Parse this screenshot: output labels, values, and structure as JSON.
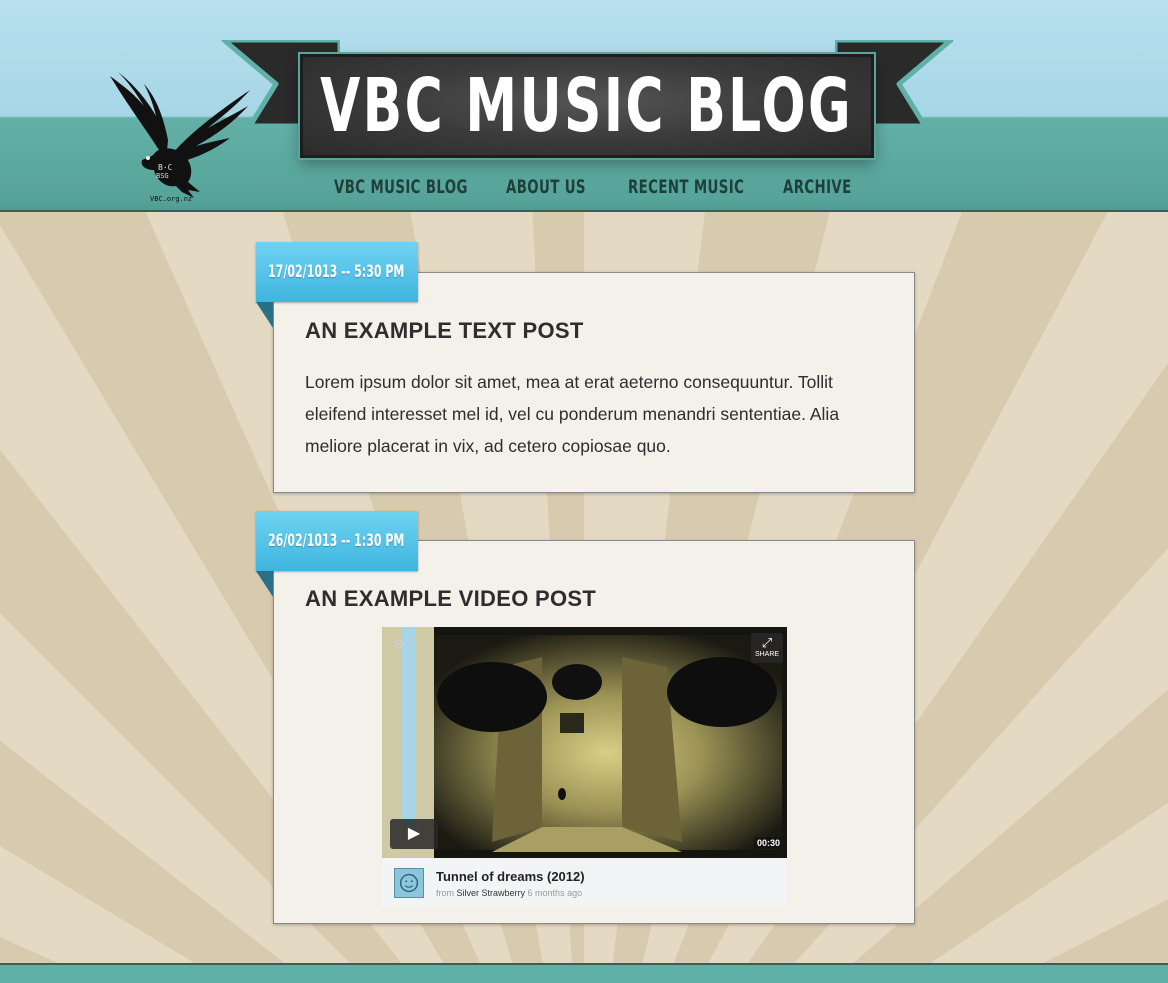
{
  "site": {
    "title": "VBC MUSIC BLOG",
    "logo_caption": "VBC.org.nz",
    "logo_icon": "eagle-icon"
  },
  "nav": {
    "items": [
      {
        "label": "VBC MUSIC BLOG"
      },
      {
        "label": "ABOUT US"
      },
      {
        "label": "RECENT MUSIC"
      },
      {
        "label": "ARCHIVE"
      }
    ]
  },
  "posts": [
    {
      "date": "17/02/1013 -- 5:30 PM",
      "title": "AN EXAMPLE TEXT POST",
      "body": "Lorem ipsum dolor sit amet, mea at erat aeterno consequuntur. Tollit eleifend interesset mel id, vel cu ponderum menandri sententiae. Alia meliore placerat in vix, ad cetero copiosae quo."
    },
    {
      "date": "26/02/1013 -- 1:30 PM",
      "title": "AN EXAMPLE VIDEO POST",
      "video": {
        "title": "Tunnel of dreams (2012)",
        "from_label": "from",
        "author": "Silver Strawberry",
        "age": "6 months ago",
        "duration": "00:30",
        "share_label": "SHARE"
      }
    }
  ],
  "colors": {
    "header_teal": "#5fb0a6",
    "sky": "#b8e0ee",
    "date_tab": "#4cc2e8",
    "banner_dark": "#3b3b3b"
  }
}
